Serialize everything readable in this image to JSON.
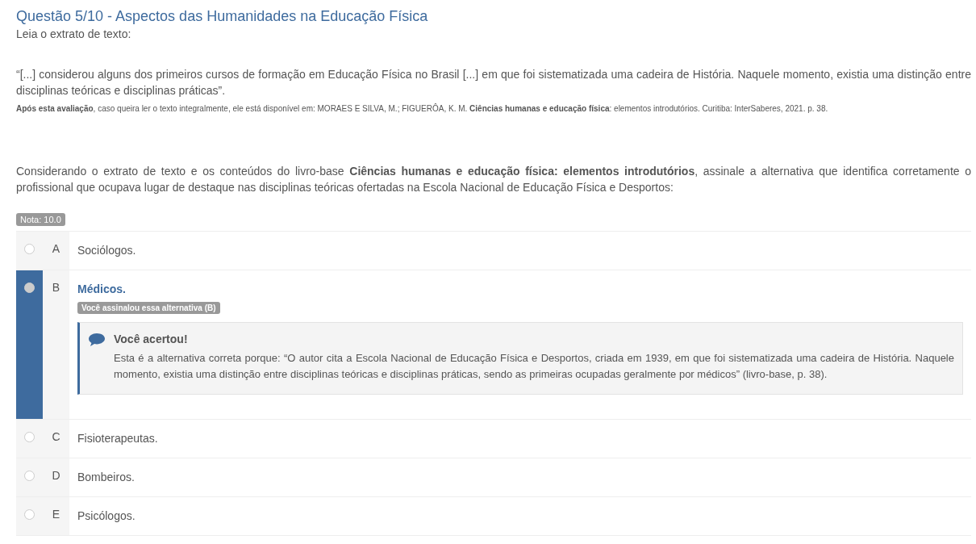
{
  "title": "Questão 5/10 - Aspectos das Humanidades na Educação Física",
  "intro": "Leia o extrato de texto:",
  "quote": "“[...] considerou alguns dos primeiros cursos de formação em Educação Física no Brasil [...] em que foi sistematizada uma cadeira de História. Naquele momento, existia uma distinção entre disciplinas teóricas e disciplinas práticas”.",
  "source": "**Após esta avaliação**, caso queira ler o texto integralmente, ele está disponível em: MORAES E SILVA, M.; FIGUERÔA, K. M. **Ciências humanas e educação física**: elementos introdutórios. Curitiba: InterSaberes, 2021. p. 38.",
  "question": "Considerando o extrato de texto e os conteúdos do livro-base **Ciências humanas e educação física: elementos introdutórios**, assinale a alternativa que identifica corretamente o profissional que ocupava lugar de destaque nas disciplinas teóricas ofertadas na Escola Nacional de Educação Física e Desportos:",
  "grade": "Nota: 10.0",
  "options": [
    {
      "letter": "A",
      "text": "Sociólogos.",
      "selected": false
    },
    {
      "letter": "B",
      "text": "Médicos.",
      "selected": true,
      "badge": "Você assinalou essa alternativa (B)",
      "feedback": {
        "title": "Você acertou!",
        "body": "Esta é a alternativa correta porque: “O autor cita a Escola Nacional de Educação Física e Desportos, criada em 1939, em que foi sistematizada uma cadeira de História. Naquele momento, existia uma distinção entre disciplinas teóricas e disciplinas práticas, sendo as primeiras ocupadas geralmente por médicos” (livro-base, p. 38)."
      }
    },
    {
      "letter": "C",
      "text": "Fisioterapeutas.",
      "selected": false
    },
    {
      "letter": "D",
      "text": "Bombeiros.",
      "selected": false
    },
    {
      "letter": "E",
      "text": "Psicólogos.",
      "selected": false
    }
  ]
}
